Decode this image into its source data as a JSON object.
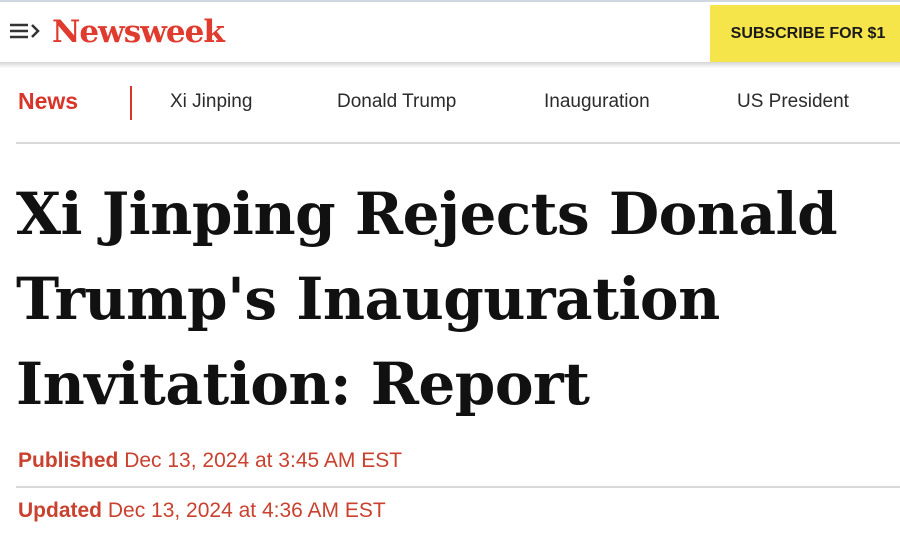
{
  "header": {
    "logo": "Newsweek",
    "subscribe_label": "SUBSCRIBE FOR $1"
  },
  "nav": {
    "section": "News",
    "links": [
      "Xi Jinping",
      "Donald Trump",
      "Inauguration",
      "US President"
    ]
  },
  "article": {
    "headline_lines": [
      "Xi Jinping Rejects Donald",
      "Trump's Inauguration",
      "Invitation: Report"
    ],
    "published_label": "Published",
    "published_date": "Dec 13, 2024 at 3:45 AM EST",
    "updated_label": "Updated",
    "updated_date": "Dec 13, 2024 at 4:36 AM EST"
  },
  "colors": {
    "brand_red": "#e03b2f",
    "subscribe_yellow": "#f5e44a"
  },
  "icons": {
    "menu": "menu-arrow-icon"
  }
}
